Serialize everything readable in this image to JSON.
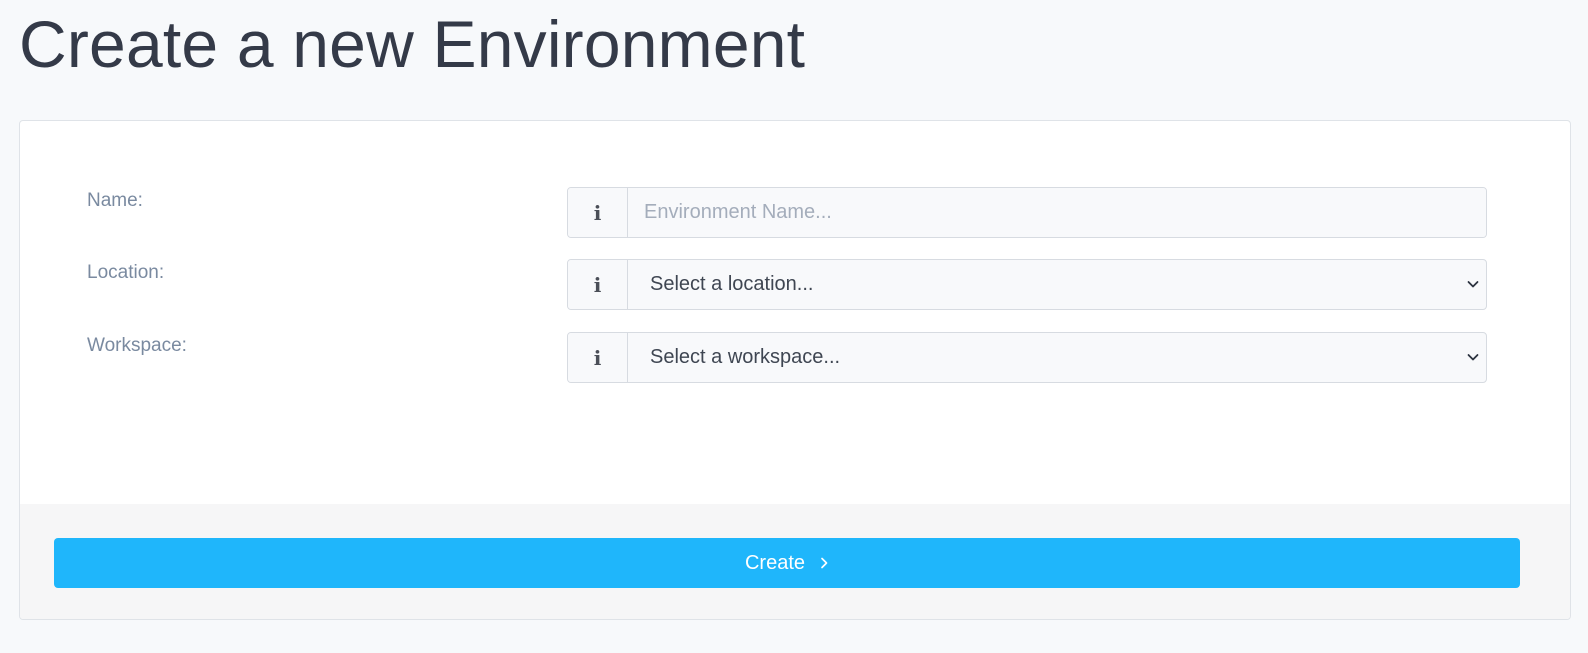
{
  "page": {
    "title": "Create a new Environment"
  },
  "form": {
    "name": {
      "label": "Name:",
      "placeholder": "Environment Name...",
      "value": "",
      "icon": "info-icon"
    },
    "location": {
      "label": "Location:",
      "selected": "Select a location...",
      "icon": "info-icon"
    },
    "workspace": {
      "label": "Workspace:",
      "selected": "Select a workspace...",
      "icon": "info-icon"
    }
  },
  "footer": {
    "create_label": "Create",
    "create_icon": "chevron-right-icon"
  },
  "colors": {
    "primary": "#1fb6fb",
    "background": "#f7f9fb",
    "label": "#7a8aa0",
    "title": "#343a48"
  }
}
